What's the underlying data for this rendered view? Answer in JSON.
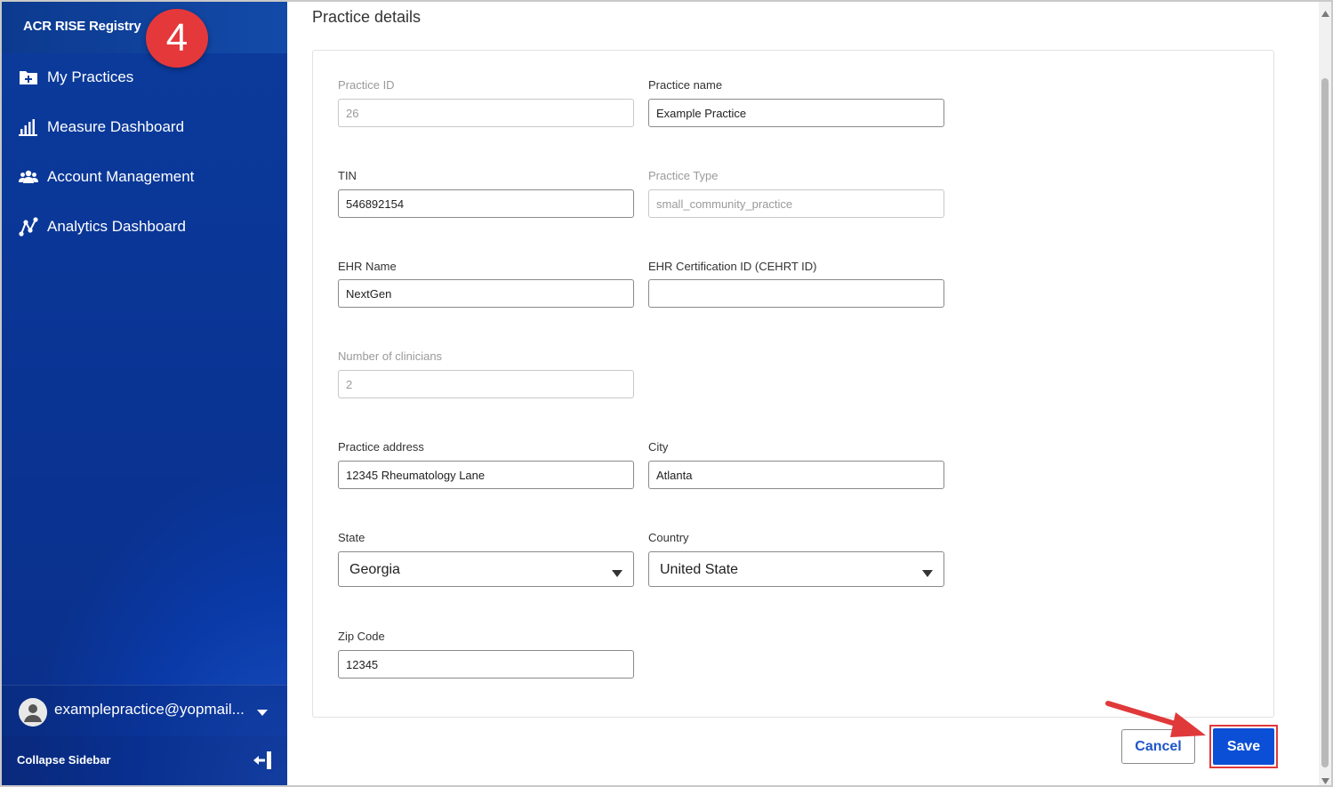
{
  "sidebar": {
    "brand": "ACR RISE Registry",
    "step_badge": "4",
    "items": [
      {
        "label": "My Practices",
        "icon": "folder-plus-icon"
      },
      {
        "label": "Measure Dashboard",
        "icon": "bar-chart-icon"
      },
      {
        "label": "Account Management",
        "icon": "users-icon"
      },
      {
        "label": "Analytics Dashboard",
        "icon": "analytics-icon"
      }
    ],
    "user_email": "examplepractice@yopmail...",
    "collapse_label": "Collapse Sidebar"
  },
  "main": {
    "title": "Practice details",
    "fields": {
      "practice_id": {
        "label": "Practice ID",
        "value": "26"
      },
      "practice_name": {
        "label": "Practice name",
        "value": "Example Practice"
      },
      "tin": {
        "label": "TIN",
        "value": "546892154"
      },
      "practice_type": {
        "label": "Practice Type",
        "value": "small_community_practice"
      },
      "ehr_name": {
        "label": "EHR Name",
        "value": "NextGen"
      },
      "ehr_cert": {
        "label": "EHR Certification ID (CEHRT ID)",
        "value": ""
      },
      "num_clinicians": {
        "label": "Number of clinicians",
        "value": "2"
      },
      "address": {
        "label": "Practice address",
        "value": "12345 Rheumatology Lane"
      },
      "city": {
        "label": "City",
        "value": "Atlanta"
      },
      "state": {
        "label": "State",
        "value": "Georgia"
      },
      "country": {
        "label": "Country",
        "value": "United State"
      },
      "zip": {
        "label": "Zip Code",
        "value": "12345"
      }
    },
    "actions": {
      "cancel": "Cancel",
      "save": "Save"
    }
  },
  "colors": {
    "sidebar": "#0b3b9c",
    "badge": "#e5383b",
    "primary": "#0a4fd6",
    "annotation": "#e0393a"
  }
}
